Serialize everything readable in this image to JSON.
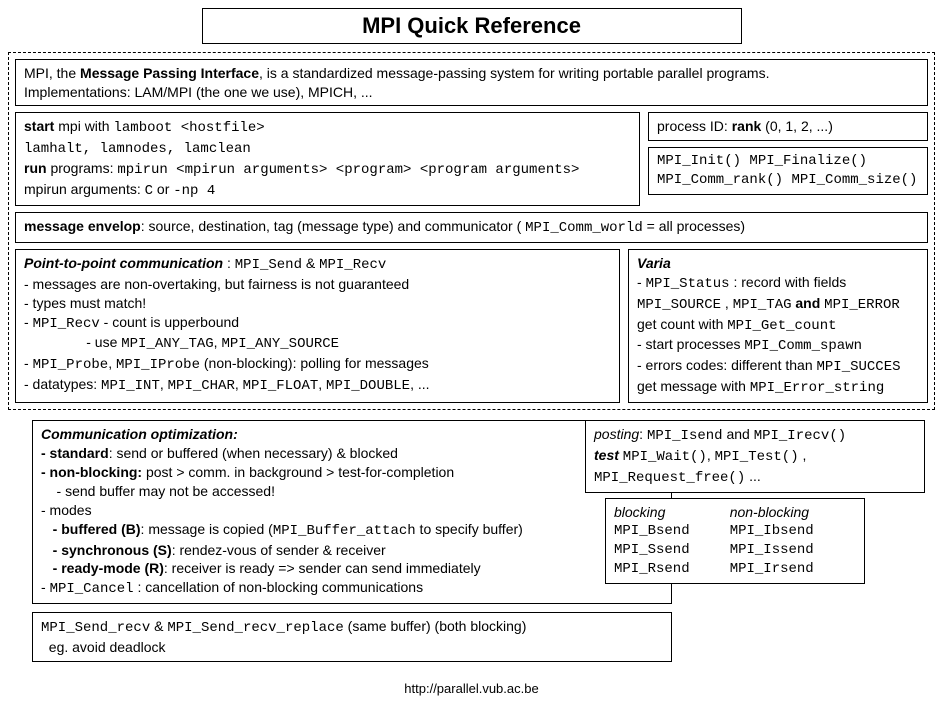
{
  "title": "MPI Quick Reference",
  "intro": {
    "line1_pre": "MPI, the ",
    "line1_b": "Message Passing Interface",
    "line1_post": ", is a standardized message-passing system for writing portable parallel programs.",
    "line2": "Implementations: LAM/MPI (the one we use), MPICH, ..."
  },
  "startbox": {
    "start_b": "start",
    "start_txt": " mpi with ",
    "start_cmd": "lamboot <hostfile>",
    "line2": "lamhalt, lamnodes, lamclean",
    "run_b": "run",
    "run_txt": " programs: ",
    "run_cmd": "mpirun <mpirun arguments> <program> <program arguments>",
    "args_pre": "   mpirun arguments: ",
    "args_cmd": "C",
    "args_mid": " or ",
    "args_cmd2": "-np 4"
  },
  "rank": {
    "pre": "process ID: ",
    "b": "rank",
    "post": " (0, 1, 2, ...)"
  },
  "funcs": {
    "a": "MPI_Init()",
    "b": "MPI_Finalize()",
    "c": "MPI_Comm_rank()",
    "d": "MPI_Comm_size()"
  },
  "envelop": {
    "b": "message envelop",
    "post": ": source, destination, tag (message type) and communicator ( ",
    "code": "MPI_Comm_world",
    "post2": " = all processes)"
  },
  "ptp": {
    "heading_pre": "Point-to-point communication",
    "heading_mid": " : ",
    "heading_c1": "MPI_Send",
    "heading_amp": " & ",
    "heading_c2": "MPI_Recv",
    "l1": " - messages are non-overtaking, but fairness is not guaranteed",
    "l2": " - types must match!",
    "l3_pre": " - ",
    "l3_code": "MPI_Recv",
    "l3_post": " - count is upperbound",
    "l4_pre": "                - use ",
    "l4_c1": "MPI_ANY_TAG",
    "l4_c2": "MPI_ANY_SOURCE",
    "l5_pre": " - ",
    "l5_c1": "MPI_Probe",
    "l5_mid": ", ",
    "l5_c2": "MPI_IProbe",
    "l5_post": " (non-blocking): polling for messages",
    "l6_pre": " - datatypes: ",
    "l6_c1": "MPI_INT",
    "l6_c2": "MPI_CHAR",
    "l6_c3": "MPI_FLOAT",
    "l6_c4": "MPI_DOUBLE",
    "l6_post": ", ..."
  },
  "varia": {
    "title": "Varia",
    "l1_pre": " - ",
    "l1_c": "MPI_Status",
    "l1_post": " : record with fields",
    "l2_c1": "MPI_SOURCE",
    "l2_mid1": " , ",
    "l2_c2": "MPI_TAG",
    "l2_and": " and ",
    "l2_c3": "MPI_ERROR",
    "l3_pre": "get count with ",
    "l3_c": "MPI_Get_count",
    "l4_pre": " - start processes ",
    "l4_c": "MPI_Comm_spawn",
    "l5_pre": " - errors codes: different than ",
    "l5_c": "MPI_SUCCES",
    "l6_pre": "get message with ",
    "l6_c": "MPI_Error_string"
  },
  "opt": {
    "title": "Communication optimization:",
    "std_b": " - standard",
    "std_post": ": send or buffered (when necessary) & blocked",
    "nb_b": " - non-blocking:",
    "nb_post": " post > comm. in background > test-for-completion",
    "nb2": "    - send buffer may not be accessed!",
    "modes": " - modes",
    "buf_b": "   - buffered (B)",
    "buf_post": ": message is copied (",
    "buf_c": "MPI_Buffer_attach",
    "buf_post2": "   to specify buffer)",
    "syn_b": "   - synchronous (S)",
    "syn_post": ": rendez-vous of sender & receiver",
    "rdy_b": "   - ready-mode (R)",
    "rdy_post": ": receiver is ready => sender can send immediately",
    "cancel_pre": " - ",
    "cancel_c": "MPI_Cancel",
    "cancel_post": " : cancellation of non-blocking communications"
  },
  "post": {
    "l1_i": "posting",
    "l1_mid": ": ",
    "l1_c1": "MPI_Isend",
    "l1_and": " and ",
    "l1_c2": "MPI_Irecv()",
    "l2_i": "test",
    "l2_sp": " ",
    "l2_c1": "MPI_Wait()",
    "l2_c2": "MPI_Test()",
    "l2_c3": "MPI_Request_free()",
    "l2_dots": " ..."
  },
  "modesbox": {
    "h1": "blocking",
    "h2": "non-blocking",
    "r1a": "MPI_Bsend",
    "r1b": "MPI_Ibsend",
    "r2a": "MPI_Ssend",
    "r2b": "MPI_Issend",
    "r3a": "MPI_Rsend",
    "r3b": "MPI_Irsend"
  },
  "sendrecv": {
    "c1": "MPI_Send_recv",
    "amp": " & ",
    "c2": "MPI_Send_recv_replace",
    "post": " (same buffer) (both blocking)",
    "l2": "  eg. avoid deadlock"
  },
  "footer": "http://parallel.vub.ac.be"
}
